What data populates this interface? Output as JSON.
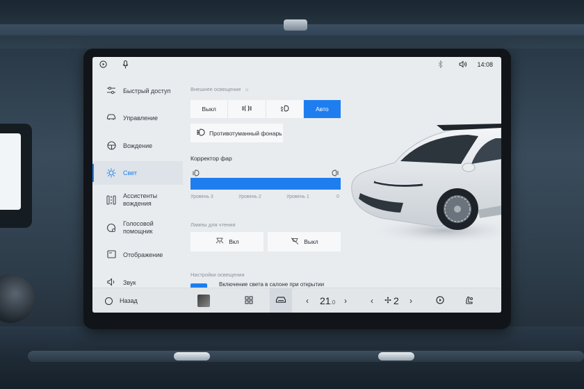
{
  "status_bar": {
    "time": "14:08"
  },
  "sidebar": {
    "items": [
      {
        "label": "Быстрый доступ",
        "icon": "sliders-icon"
      },
      {
        "label": "Управление",
        "icon": "car-icon"
      },
      {
        "label": "Вождение",
        "icon": "steering-wheel-icon"
      },
      {
        "label": "Свет",
        "icon": "sun-icon",
        "active": true
      },
      {
        "label": "Ассистенты вождения",
        "icon": "assist-icon"
      },
      {
        "label": "Голосовой помощник",
        "icon": "voice-assistant-icon"
      },
      {
        "label": "Отображение",
        "icon": "display-icon"
      },
      {
        "label": "Звук",
        "icon": "speaker-icon"
      }
    ]
  },
  "exterior": {
    "title": "Внешнее освещение",
    "modes": [
      {
        "label": "Выкл",
        "icon": ""
      },
      {
        "label": "",
        "icon": "parking-lights-icon"
      },
      {
        "label": "",
        "icon": "low-beam-icon"
      },
      {
        "label": "Авто",
        "icon": "",
        "active": true
      }
    ],
    "fog_label": "Противотуманный фонарь"
  },
  "headlight_corrector": {
    "title": "Корректор фар",
    "levels": [
      "Уровень 3",
      "Уровень 2",
      "Уровень 1",
      "0"
    ],
    "value_fraction": 1.0
  },
  "reading_lamps": {
    "title": "Лампы для чтения",
    "on_label": "Вкл",
    "off_label": "Выкл"
  },
  "light_settings": {
    "title": "Настройки освещения",
    "cabin_on_open": "Включение света в салоне при открытии"
  },
  "bottom_bar": {
    "back_label": "Назад",
    "temperature_value": "21",
    "temperature_decimal": ".0",
    "fan_value": "2"
  },
  "colors": {
    "accent": "#1e7ef0",
    "screen_bg": "#e9ecef"
  }
}
